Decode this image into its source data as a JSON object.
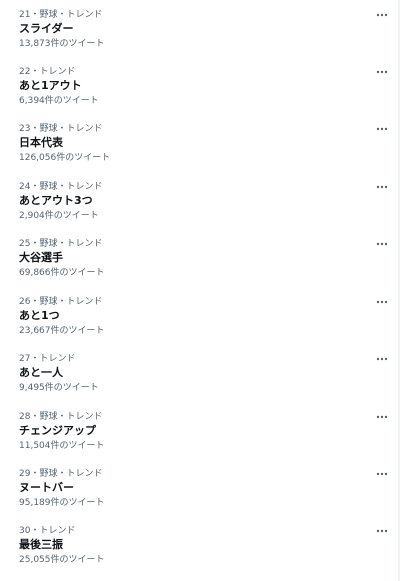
{
  "trends": [
    {
      "meta": "21・野球・トレンド",
      "name": "スライダー",
      "count": "13,873件のツイート",
      "more_icon": "more-icon"
    },
    {
      "meta": "22・トレンド",
      "name": "あと1アウト",
      "count": "6,394件のツイート",
      "more_icon": "more-icon"
    },
    {
      "meta": "23・野球・トレンド",
      "name": "日本代表",
      "count": "126,056件のツイート",
      "more_icon": "more-icon"
    },
    {
      "meta": "24・野球・トレンド",
      "name": "あとアウト3つ",
      "count": "2,904件のツイート",
      "more_icon": "more-icon"
    },
    {
      "meta": "25・野球・トレンド",
      "name": "大谷選手",
      "count": "69,866件のツイート",
      "more_icon": "more-icon"
    },
    {
      "meta": "26・野球・トレンド",
      "name": "あと1つ",
      "count": "23,667件のツイート",
      "more_icon": "more-icon"
    },
    {
      "meta": "27・トレンド",
      "name": "あと一人",
      "count": "9,495件のツイート",
      "more_icon": "more-icon"
    },
    {
      "meta": "28・野球・トレンド",
      "name": "チェンジアップ",
      "count": "11,504件のツイート",
      "more_icon": "more-icon"
    },
    {
      "meta": "29・野球・トレンド",
      "name": "ヌートバー",
      "count": "95,189件のツイート",
      "more_icon": "more-icon"
    },
    {
      "meta": "30・トレンド",
      "name": "最後三振",
      "count": "25,055件のツイート",
      "more_icon": "more-icon"
    }
  ],
  "colors": {
    "text_primary": "#0f1419",
    "text_secondary": "#536471",
    "background": "#ffffff"
  }
}
